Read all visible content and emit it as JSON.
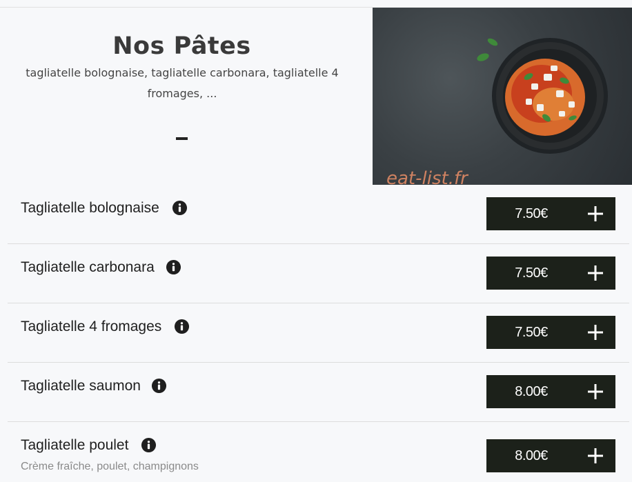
{
  "section": {
    "title": "Nos Pâtes",
    "subtitle": "tagliatelle bolognaise, tagliatelle carbonara, tagliatelle 4 fromages, ...",
    "separator": "-"
  },
  "watermark": "eat-list.fr",
  "items": [
    {
      "name": "Tagliatelle bolognaise",
      "price": "7.50€",
      "desc": ""
    },
    {
      "name": "Tagliatelle carbonara",
      "price": "7.50€",
      "desc": ""
    },
    {
      "name": "Tagliatelle 4 fromages",
      "price": "7.50€",
      "desc": ""
    },
    {
      "name": "Tagliatelle saumon",
      "price": "8.00€",
      "desc": ""
    },
    {
      "name": "Tagliatelle poulet",
      "price": "8.00€",
      "desc": "Crème fraîche, poulet, champignons"
    }
  ],
  "icons": {
    "info": "info-icon",
    "add": "plus-icon"
  },
  "colors": {
    "button_bg": "#1c211a",
    "watermark": "#e08a65",
    "background": "#f7f8fa"
  }
}
